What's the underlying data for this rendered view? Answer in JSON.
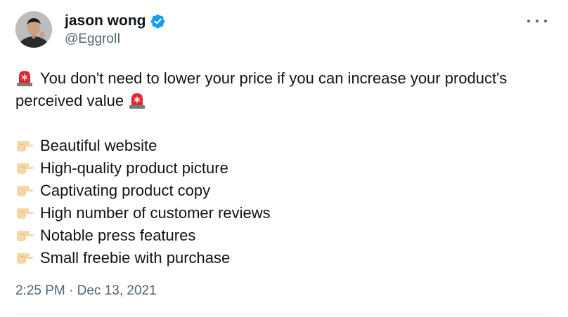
{
  "author": {
    "display_name": "jason wong",
    "handle": "@EggrolI",
    "verified_icon": "verified-badge-icon",
    "avatar_icon": "profile-photo"
  },
  "tweet": {
    "headline": "You don't need to lower your price if you can increase your product's",
    "headline_cont": "perceived value",
    "lead_emoji": "police-siren-emoji",
    "list_emoji": "pointing-right-hand-emoji",
    "list": [
      "Beautiful website",
      "High-quality product picture",
      "Captivating product copy",
      "High number of customer reviews",
      "Notable press features",
      "Small freebie with purchase"
    ],
    "timestamp": "2:25 PM · Dec 13, 2021"
  },
  "menu": {
    "icon": "more-options-icon"
  },
  "colors": {
    "text": "#0f1419",
    "secondary": "#536471",
    "verified": "#1d9bf0",
    "siren": "#e0242f"
  }
}
